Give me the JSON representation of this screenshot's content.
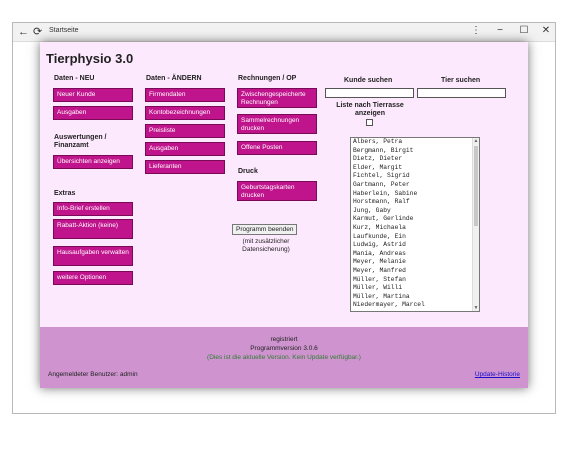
{
  "window": {
    "back_icon": "back-arrow-icon",
    "reload_icon": "reload-icon",
    "title": "Startseite",
    "menu_glyph": "⋮",
    "minimize_glyph": "−",
    "maximize_glyph": "☐",
    "close_glyph": "✕"
  },
  "app": {
    "title": "Tierphysio 3.0",
    "accent_color": "#c0148d",
    "background_color": "#fde9fd",
    "footer_color": "#cf94cf"
  },
  "col1": {
    "header_new": "Daten - NEU",
    "btn_new_customer": "Neuer Kunde",
    "btn_expenses": "Ausgaben",
    "header_reports": "Auswertungen / Finanzamt",
    "btn_overviews": "Übersichten anzeigen",
    "header_extras": "Extras",
    "btn_info_letter": "Info-Brief erstellen",
    "btn_discount": "Rabatt-Aktion (keine)",
    "btn_homework": "Hausaufgaben verwalten",
    "btn_more_options": "weitere Optionen"
  },
  "col2": {
    "header": "Daten - ÄNDERN",
    "btn_company": "Firmendaten",
    "btn_accounts": "Kontobezeichnungen",
    "btn_prices": "Preisliste",
    "btn_expenses": "Ausgaben",
    "btn_suppliers": "Lieferanten"
  },
  "col3": {
    "header_invoices": "Rechnungen / OP",
    "btn_cached_invoices": "Zwischengespeicherte Rechnungen",
    "btn_collective_invoices": "Sammelrechnungen drucken",
    "btn_open_items": "Offene Posten",
    "header_print": "Druck",
    "btn_birthday_cards": "Geburtstagskarten drucken",
    "btn_quit": "Programm beenden",
    "quit_note": "(mit zusätzlicher Datensicherung)"
  },
  "search": {
    "customer_label": "Kunde suchen",
    "animal_label": "Tier suchen",
    "breed_list_label": "Liste nach Tierrasse anzeigen",
    "customer_value": "",
    "animal_value": ""
  },
  "customers": [
    "Albers, Petra",
    "Bergmann, Birgit",
    "Dietz, Dieter",
    "Elder, Margit",
    "Fichtel, Sigrid",
    "Gartmann, Peter",
    "Haberlein, Sabine",
    "Horstmann, Ralf",
    "Jung, Gaby",
    "Karmut, Gerlinde",
    "Kurz, Michaela",
    "Laufkunde, Ein",
    "Ludwig, Astrid",
    "Mania, Andreas",
    "Meyer, Melanie",
    "Meyer, Manfred",
    "Müller, Stefan",
    "Müller, Willi",
    "Müller, Martina",
    "Niedermayer, Marcel"
  ],
  "footer": {
    "registered": "registriert",
    "version": "Programmversion 3.0.6",
    "update_status": "(Dies ist die aktuelle Version. Kein Update verfügbar.)",
    "user": "Angemeldeter Benutzer: admin",
    "update_history": "Update-Historie"
  }
}
